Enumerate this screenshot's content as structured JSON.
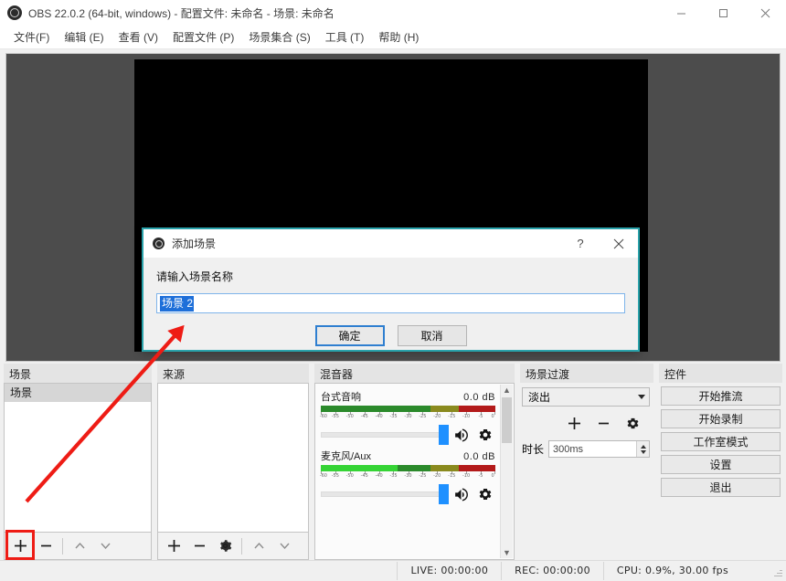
{
  "window": {
    "title": "OBS 22.0.2 (64-bit, windows) - 配置文件: 未命名 - 场景: 未命名",
    "app_icon": "obs-logo-icon",
    "minimize": "−",
    "maximize": "▢",
    "close": "✕"
  },
  "menubar": {
    "items": [
      {
        "label": "文件(F)"
      },
      {
        "label": "编辑 (E)"
      },
      {
        "label": "查看 (V)"
      },
      {
        "label": "配置文件 (P)"
      },
      {
        "label": "场景集合 (S)"
      },
      {
        "label": "工具 (T)"
      },
      {
        "label": "帮助 (H)"
      }
    ]
  },
  "docks": {
    "scenes": {
      "title": "场景",
      "items": [
        {
          "label": "场景",
          "selected": true
        }
      ],
      "toolbar": {
        "add": "+",
        "remove": "−",
        "move_up": "∧",
        "move_down": "∨"
      },
      "highlight_color": "#ee1c15"
    },
    "sources": {
      "title": "来源",
      "items": [],
      "toolbar": {
        "add": "+",
        "remove": "−",
        "properties": "gear",
        "move_up": "∧",
        "move_down": "∨"
      }
    },
    "mixer": {
      "title": "混音器",
      "channels": [
        {
          "name": "台式音响",
          "db": "0.0",
          "db_unit": "dB",
          "level": 0,
          "muted": false
        },
        {
          "name": "麦克风/Aux",
          "db": "0.0",
          "db_unit": "dB",
          "level": 62,
          "muted": false
        }
      ],
      "scale_labels": [
        "-60",
        "-55",
        "-50",
        "-45",
        "-40",
        "-35",
        "-30",
        "-25",
        "-20",
        "-15",
        "-10",
        "-5",
        "0"
      ]
    },
    "transitions": {
      "title": "场景过渡",
      "selected_transition": "淡出",
      "add": "+",
      "remove": "−",
      "properties": "gear",
      "duration_label": "时长",
      "duration_value": "300ms"
    },
    "controls": {
      "title": "控件",
      "buttons": [
        {
          "label": "开始推流"
        },
        {
          "label": "开始录制"
        },
        {
          "label": "工作室模式"
        },
        {
          "label": "设置"
        },
        {
          "label": "退出"
        }
      ]
    }
  },
  "statusbar": {
    "live": "LIVE: 00:00:00",
    "rec": "REC: 00:00:00",
    "cpu": "CPU: 0.9%, 30.00 fps"
  },
  "dialog": {
    "title": "添加场景",
    "icon": "obs-logo-icon",
    "help": "?",
    "close": "✕",
    "label": "请输入场景名称",
    "input_value": "场景 2",
    "ok": "确定",
    "cancel": "取消",
    "border_color": "#2aa3ab"
  },
  "annotation": {
    "arrow_color": "#ee1c15",
    "description": "红色箭头从场景添加按钮指向添加场景对话框"
  }
}
